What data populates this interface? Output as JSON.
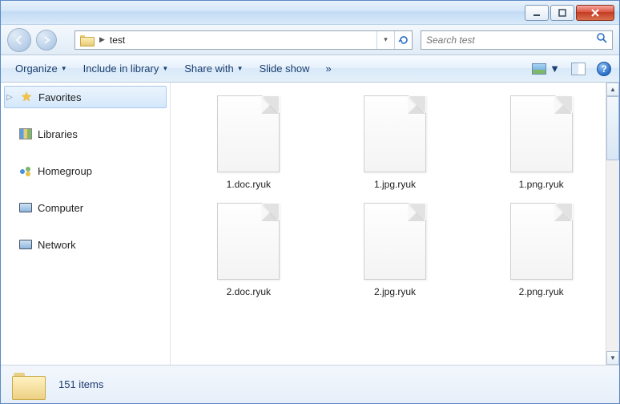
{
  "breadcrumb": {
    "current": "test"
  },
  "search": {
    "placeholder": "Search test"
  },
  "toolbar": {
    "organize": "Organize",
    "include": "Include in library",
    "share": "Share with",
    "slideshow": "Slide show"
  },
  "nav": {
    "favorites": "Favorites",
    "libraries": "Libraries",
    "homegroup": "Homegroup",
    "computer": "Computer",
    "network": "Network"
  },
  "files": [
    {
      "name": "1.doc.ryuk"
    },
    {
      "name": "1.jpg.ryuk"
    },
    {
      "name": "1.png.ryuk"
    },
    {
      "name": "2.doc.ryuk"
    },
    {
      "name": "2.jpg.ryuk"
    },
    {
      "name": "2.png.ryuk"
    }
  ],
  "status": {
    "count_text": "151 items"
  }
}
